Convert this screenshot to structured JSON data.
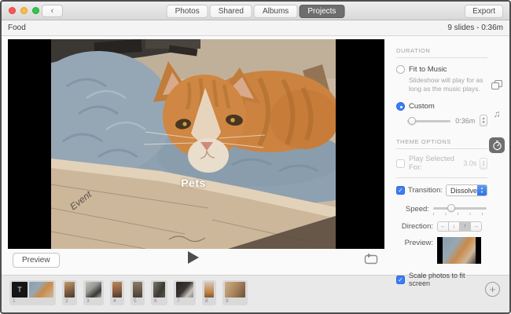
{
  "window": {
    "back_glyph": "‹",
    "tabs": [
      {
        "label": "Photos",
        "active": false
      },
      {
        "label": "Shared",
        "active": false
      },
      {
        "label": "Albums",
        "active": false
      },
      {
        "label": "Projects",
        "active": true
      }
    ],
    "export_label": "Export"
  },
  "header": {
    "project_title": "Food",
    "slides_summary": "9 slides - 0:36m"
  },
  "canvas": {
    "overlay_title": "Pets",
    "handwriting": "Event"
  },
  "sidebar": {
    "duration": {
      "section_title": "DURATION",
      "fit_to_music_label": "Fit to Music",
      "fit_to_music_desc": "Slideshow will play for as long as the music plays.",
      "custom_label": "Custom",
      "custom_value": "0:36m"
    },
    "theme_options": {
      "section_title": "THEME OPTIONS",
      "play_selected_label": "Play Selected For:",
      "play_selected_value": "3.0s",
      "transition_label": "Transition:",
      "transition_value": "Dissolve",
      "speed_label": "Speed:",
      "direction_label": "Direction:",
      "direction_options": [
        "←",
        "↓",
        "↑",
        "→"
      ],
      "direction_selected_index": 2,
      "preview_label": "Preview:",
      "scale_label": "Scale photos to fit screen"
    },
    "tool_icons": [
      "themes-icon",
      "music-icon",
      "duration-icon"
    ]
  },
  "controls": {
    "preview_label": "Preview"
  },
  "filmstrip": {
    "title_thumb_letter": "T",
    "slides": [
      {
        "number": "1",
        "thumbs": [
          "title",
          "p1"
        ]
      },
      {
        "number": "2",
        "thumbs": [
          "p2"
        ]
      },
      {
        "number": "3",
        "thumbs": [
          "p3"
        ]
      },
      {
        "number": "4",
        "thumbs": [
          "p4"
        ]
      },
      {
        "number": "5",
        "thumbs": [
          "p5"
        ]
      },
      {
        "number": "6",
        "thumbs": [
          "p6"
        ]
      },
      {
        "number": "7",
        "thumbs": [
          "p7"
        ]
      },
      {
        "number": "8",
        "thumbs": [
          "p8"
        ]
      },
      {
        "number": "9",
        "thumbs": [
          "p9"
        ]
      }
    ]
  },
  "colors": {
    "accent_blue": "#3b7cf7",
    "tab_selected": "#6e6e6e"
  }
}
